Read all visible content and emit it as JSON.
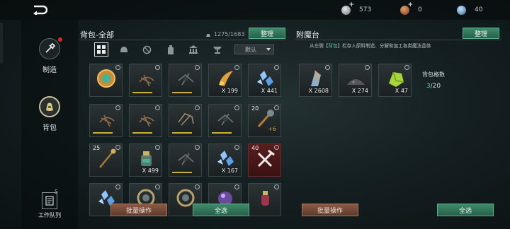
{
  "topbar": {
    "currency_1": "573",
    "currency_2": "0",
    "currency_3": "40"
  },
  "leftnav": {
    "craft_label": "制造",
    "bag_label": "背包",
    "queue_label": "工作队列",
    "queue_count": "5"
  },
  "bag": {
    "title": "背包-全部",
    "capacity": "1275/1683",
    "sort_label": "整理",
    "filter_select": "默认",
    "batch_label": "批量操作",
    "select_all_label": "全选",
    "slots": [
      {
        "qty": "",
        "lvl": "",
        "icon": "orb-gold",
        "bar": false
      },
      {
        "qty": "",
        "lvl": "",
        "icon": "spider-1",
        "bar": true
      },
      {
        "qty": "",
        "lvl": "",
        "icon": "spider-2",
        "bar": true
      },
      {
        "qty": "X 199",
        "lvl": "",
        "icon": "wing-flame",
        "bar": false
      },
      {
        "qty": "X 441",
        "lvl": "",
        "icon": "crystal-blue",
        "bar": false
      },
      {
        "qty": "",
        "lvl": "",
        "icon": "spider-1",
        "bar": true
      },
      {
        "qty": "",
        "lvl": "",
        "icon": "spider-1",
        "bar": true
      },
      {
        "qty": "",
        "lvl": "",
        "icon": "spider-3",
        "bar": true
      },
      {
        "qty": "",
        "lvl": "",
        "icon": "spider-2",
        "bar": true
      },
      {
        "qty": "",
        "lvl": "20",
        "icon": "mace",
        "bar": false,
        "plus": "+6"
      },
      {
        "qty": "",
        "lvl": "25",
        "icon": "staff",
        "bar": false
      },
      {
        "qty": "X 499",
        "lvl": "",
        "icon": "potion-jar",
        "bar": false
      },
      {
        "qty": "",
        "lvl": "",
        "icon": "spider-2",
        "bar": true
      },
      {
        "qty": "X 167",
        "lvl": "",
        "icon": "crystal-blue",
        "bar": false
      },
      {
        "qty": "",
        "lvl": "40",
        "icon": "tools",
        "bar": false,
        "red": true
      },
      {
        "qty": "",
        "lvl": "",
        "icon": "crystal-blue",
        "bar": false
      },
      {
        "qty": "",
        "lvl": "",
        "icon": "orb-ring",
        "bar": false
      },
      {
        "qty": "",
        "lvl": "",
        "icon": "orb-ring",
        "bar": false
      },
      {
        "qty": "",
        "lvl": "",
        "icon": "orb-purple",
        "bar": false
      },
      {
        "qty": "",
        "lvl": "",
        "icon": "potion-red",
        "bar": false
      }
    ]
  },
  "enchant": {
    "title": "附魔台",
    "sort_label": "整理",
    "hint_prefix": "从左侧【",
    "hint_keyword": "背包",
    "hint_suffix": "】栏存入原料制造、分解和加工各类魔法晶体",
    "slots": [
      {
        "qty": "X 2608",
        "icon": "crystal-shard"
      },
      {
        "qty": "X 274",
        "icon": "dust-pile"
      },
      {
        "qty": "X 47",
        "icon": "green-ore"
      }
    ],
    "bag_capacity_label": "背包格数",
    "bag_capacity_used": "3",
    "bag_capacity_total": "/20",
    "batch_label": "批量操作",
    "select_all_label": "全选"
  },
  "colors": {
    "accent_green": "#3f8a6a",
    "accent_brown": "#8a5a45",
    "red_dot": "#d52a2a",
    "rarity_bar": "#c9b13a"
  }
}
